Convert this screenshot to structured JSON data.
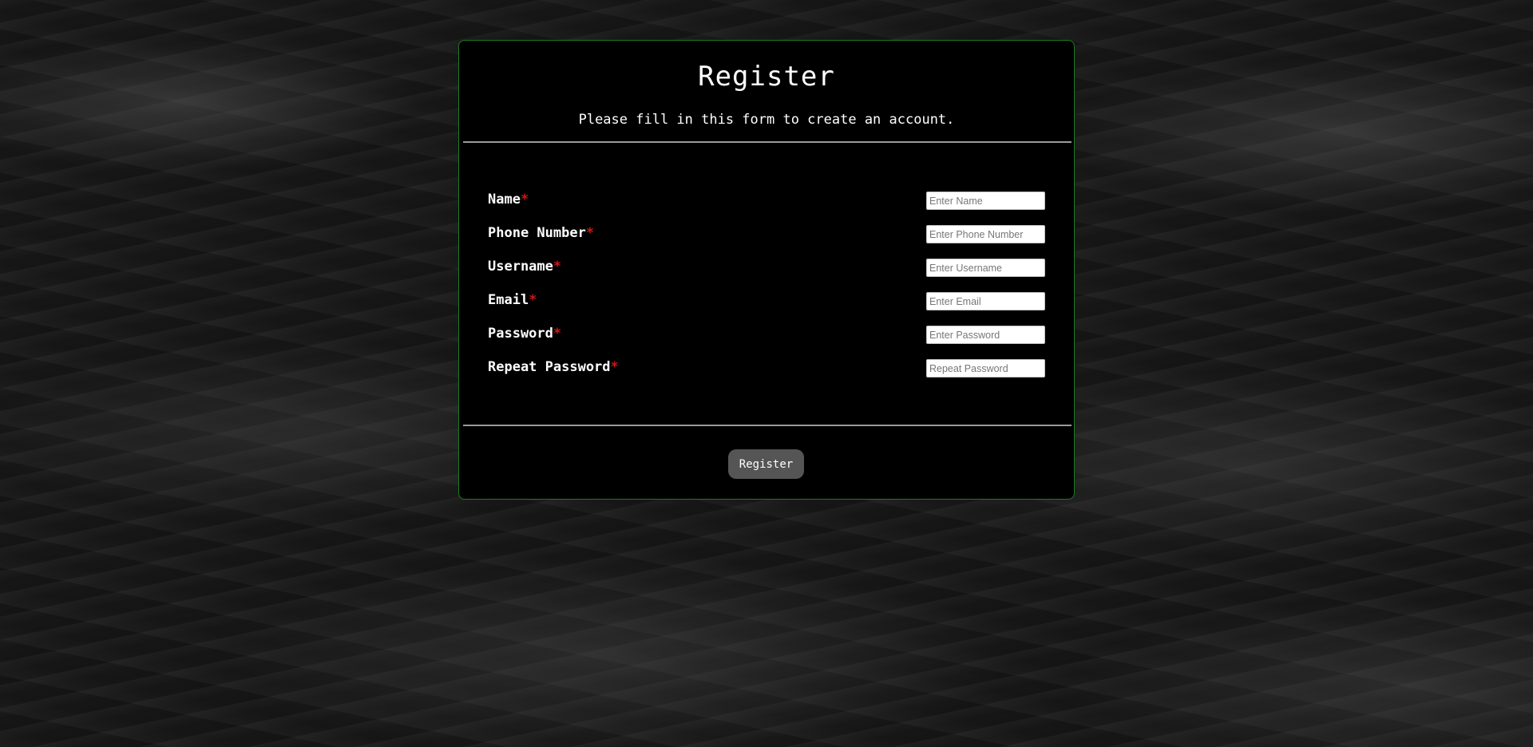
{
  "form": {
    "title": "Register",
    "subtitle": "Please fill in this form to create an account.",
    "required_marker": "*",
    "fields": [
      {
        "label": "Name",
        "placeholder": "Enter Name",
        "value": ""
      },
      {
        "label": "Phone Number",
        "placeholder": "Enter Phone Number",
        "value": ""
      },
      {
        "label": "Username",
        "placeholder": "Enter Username",
        "value": ""
      },
      {
        "label": "Email",
        "placeholder": "Enter Email",
        "value": ""
      },
      {
        "label": "Password",
        "placeholder": "Enter Password",
        "value": ""
      },
      {
        "label": "Repeat Password",
        "placeholder": "Repeat Password",
        "value": ""
      }
    ],
    "submit_label": "Register"
  },
  "colors": {
    "card_background": "#000000",
    "card_border": "#1f7a1f",
    "required_marker": "#d01515",
    "divider": "#9a9a9a",
    "button_background": "#555555",
    "text": "#ffffff"
  }
}
